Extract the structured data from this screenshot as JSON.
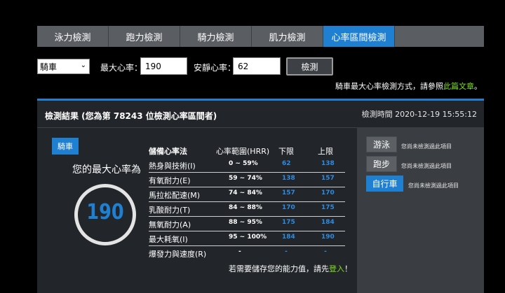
{
  "tabs": [
    {
      "label": "泳力檢測",
      "active": false
    },
    {
      "label": "跑力檢測",
      "active": false
    },
    {
      "label": "騎力檢測",
      "active": false
    },
    {
      "label": "肌力檢測",
      "active": false
    },
    {
      "label": "心率區間檢測",
      "active": true
    }
  ],
  "form": {
    "sport_selected": "騎車",
    "max_hr_label": "最大心率：",
    "max_hr_value": "190",
    "rest_hr_label": "安靜心率：",
    "rest_hr_value": "62",
    "test_button": "檢測"
  },
  "hint": {
    "text": "騎車最大心率檢測方式，請參照",
    "link": "此篇文章",
    "suffix": "。"
  },
  "result": {
    "title": "檢測結果 (您為第 78243 位檢測心率區間者)",
    "time": "檢測時間 2020-12-19 15:55:12",
    "sport_badge": "騎車",
    "max_label": "您的最大心率為",
    "max_value": "190"
  },
  "zone_table": {
    "headers": {
      "name": "儲備心率法",
      "range": "心率範圍(HRR)",
      "low": "下限",
      "up": "上限"
    },
    "rows": [
      {
        "name": "熱身與技術(I)",
        "range": "0 ~ 59%",
        "low": "62",
        "up": "138"
      },
      {
        "name": "有氧耐力(E)",
        "range": "59 ~ 74%",
        "low": "138",
        "up": "157"
      },
      {
        "name": "馬拉松配速(M)",
        "range": "74 ~ 84%",
        "low": "157",
        "up": "170"
      },
      {
        "name": "乳酸耐力(T)",
        "range": "84 ~ 88%",
        "low": "170",
        "up": "175"
      },
      {
        "name": "無氧耐力(A)",
        "range": "88 ~ 95%",
        "low": "175",
        "up": "184"
      },
      {
        "name": "最大耗氧(I)",
        "range": "95 ~ 100%",
        "low": "184",
        "up": "190"
      },
      {
        "name": "爆發力與速度(R)",
        "range": "-",
        "low": "-",
        "up": "-"
      }
    ]
  },
  "note": {
    "text": "若需要儲存您的能力值，請先",
    "link": "登入",
    "suffix": "！"
  },
  "side": {
    "items": [
      {
        "label": "游泳",
        "status": "您尚未檢測過此項目",
        "active": false
      },
      {
        "label": "跑步",
        "status": "您尚未檢測過此項目",
        "active": false
      },
      {
        "label": "自行車",
        "status": "您尚未檢測過此項目",
        "active": true
      }
    ]
  },
  "colors": {
    "accent": "#1f7fd1",
    "link": "#7ee21f",
    "panel": "#22252a",
    "side": "#3a3d42"
  }
}
